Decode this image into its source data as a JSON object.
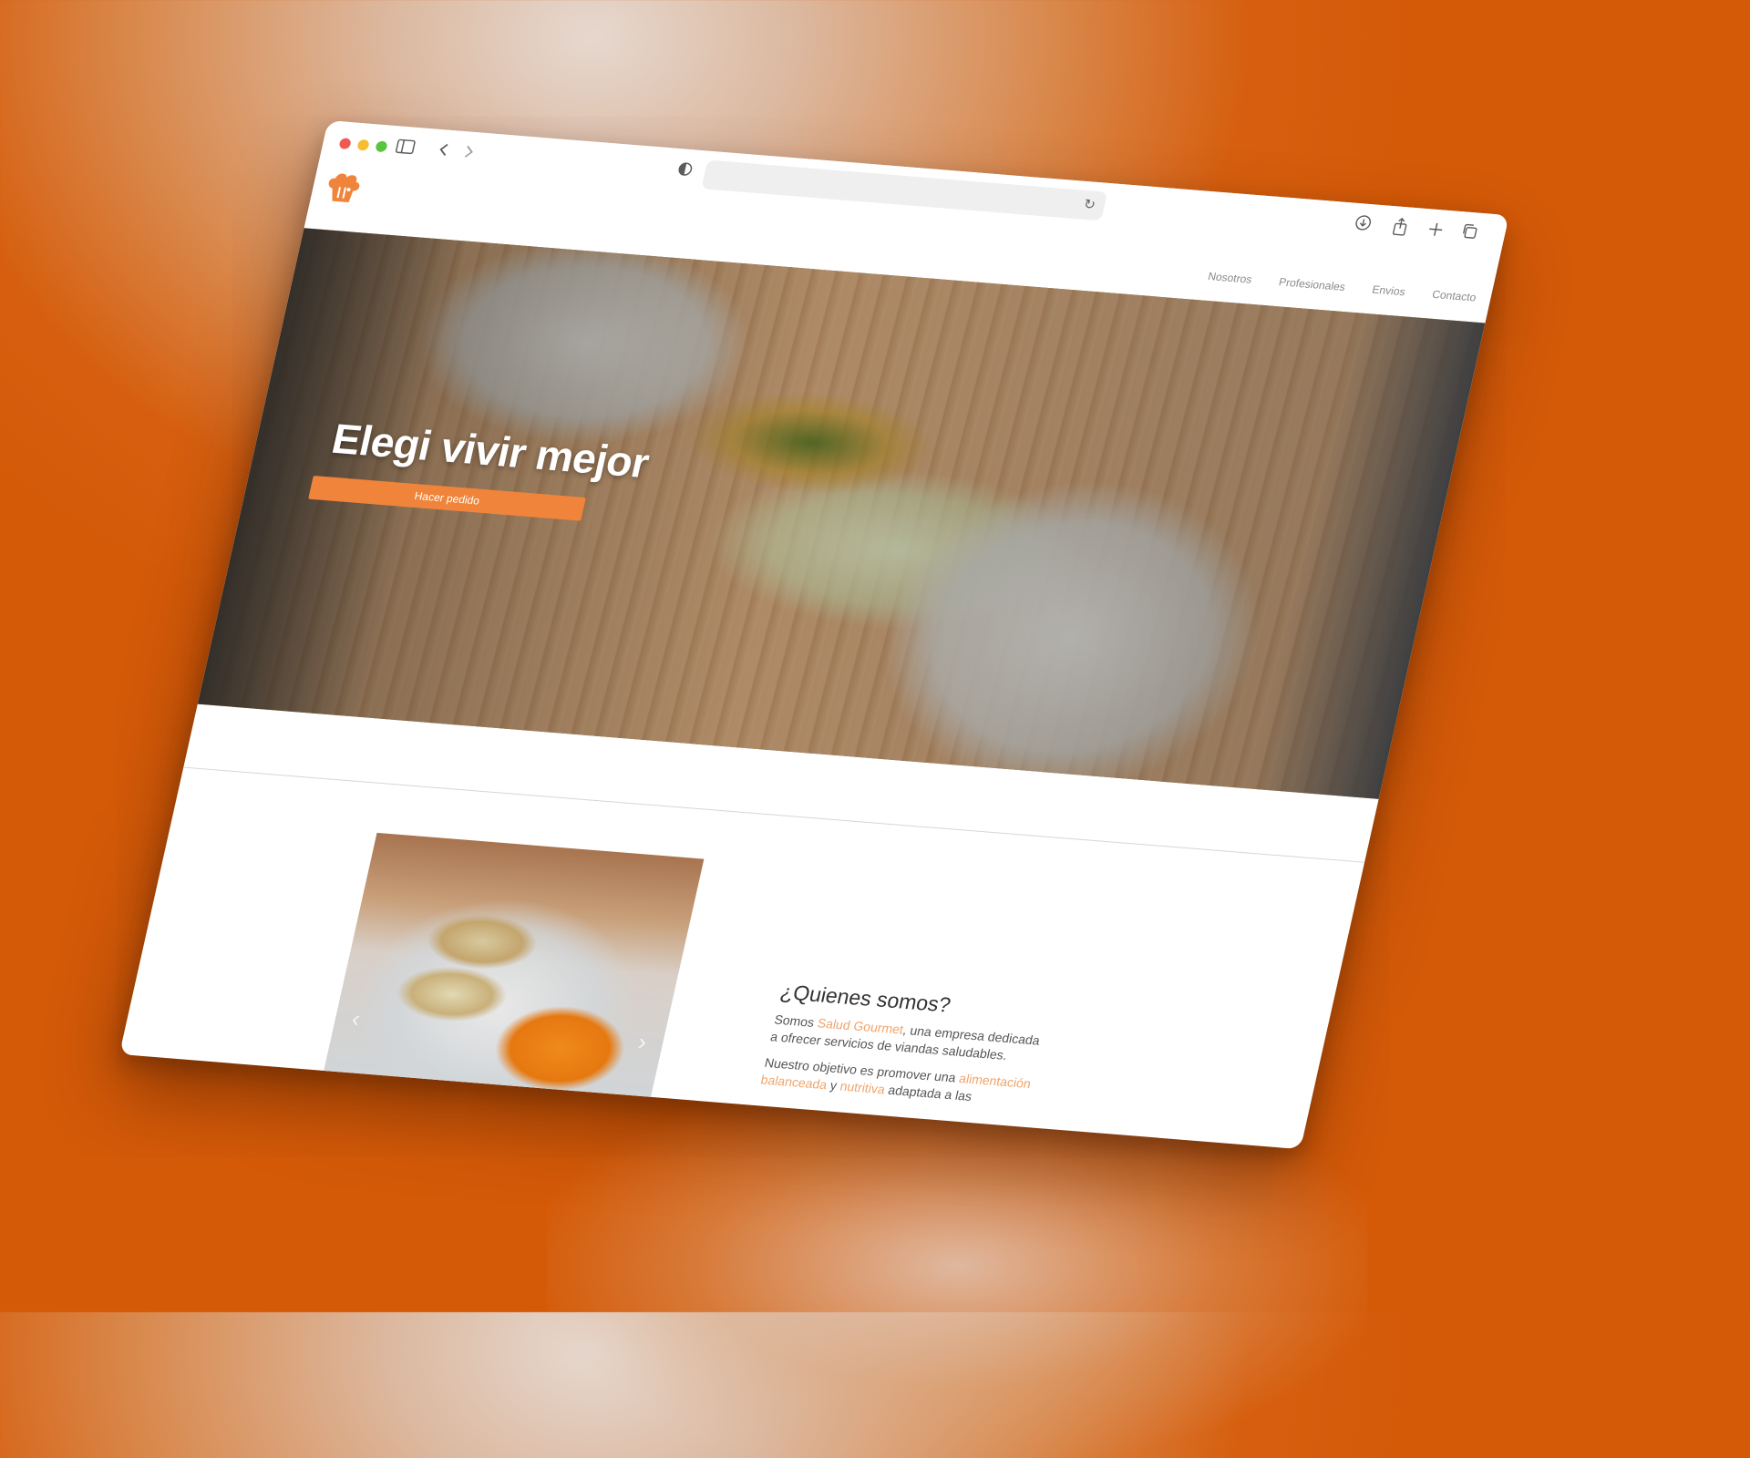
{
  "browser": {
    "back_icon": "chevron-left-icon",
    "forward_icon": "chevron-right-icon",
    "sidebar_icon": "sidebar-icon",
    "privacy_icon": "shield-half-icon",
    "reload_glyph": "↻",
    "toolbar_glyphs": {
      "download": "⊕",
      "share": "⇪",
      "new_tab": "+",
      "tabs": "⧉"
    }
  },
  "nav": {
    "links": [
      "Nosotros",
      "Profesionales",
      "Envios",
      "Contacto"
    ]
  },
  "hero": {
    "title": "Elegi vivir mejor",
    "button_label": "Hacer pedido"
  },
  "about": {
    "title": "¿Quienes somos?",
    "p1_a": "Somos ",
    "p1_highlight": "Salud Gourmet",
    "p1_b": ", una empresa dedicada a ofrecer servicios de viandas saludables.",
    "p2_a": "Nuestro objetivo es promover una ",
    "p2_highlight1": "alimentación balanceada",
    "p2_b": " y ",
    "p2_highlight2": "nutritiva",
    "p2_c": " adaptada a las",
    "carousel_prev": "‹",
    "carousel_next": "›"
  },
  "colors": {
    "accent": "#f0843a",
    "highlight": "#f0a46a",
    "background": "#d65f0f"
  }
}
